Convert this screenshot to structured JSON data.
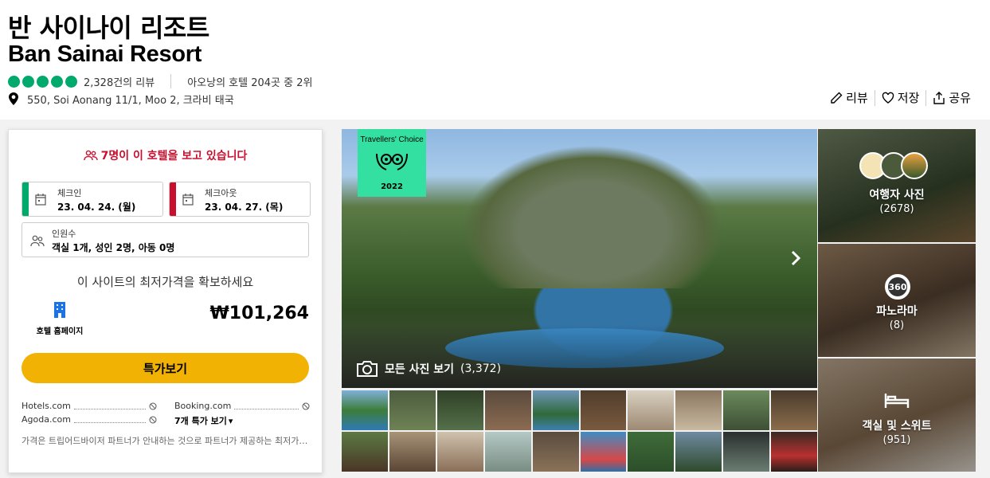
{
  "hotel": {
    "name_ko": "반 사이나이 리조트",
    "name_en": "Ban Sainai Resort",
    "reviews": "2,328건의 리뷰",
    "ranking": "아오낭의 호텔 204곳 중 2위",
    "address": "550, Soi Aonang 11/1, Moo 2, 크라비 태국",
    "rating_bubbles": 5,
    "rating_color": "#00aa6c"
  },
  "actions": {
    "review": "리뷰",
    "save": "저장",
    "share": "공유"
  },
  "booking": {
    "viewers": "7명이 이 호텔을 보고 있습니다",
    "checkin_label": "체크인",
    "checkin_value": "23. 04. 24. (월)",
    "checkout_label": "체크아웃",
    "checkout_value": "23. 04. 27. (목)",
    "guests_label": "인원수",
    "guests_value": "객실 1개, 성인 2명, 아동 0명",
    "best_price_title": "이 사이트의 최저가격을 확보하세요",
    "vendor_name": "호텔 홈페이지",
    "price": "₩101,264",
    "deal_button": "특가보기",
    "partners": [
      "Hotels.com",
      "Booking.com",
      "Agoda.com"
    ],
    "more_deals": "7개 특가 보기",
    "disclaimer": "가격은 트립어드바이저 파트너가 안내하는 것으로 파트너가 제공하는 최저가 정보입니다",
    "checkin_color": "#00aa6c",
    "checkout_color": "#c8102e",
    "deal_color": "#f2b203"
  },
  "gallery": {
    "badge_title": "Travellers' Choice",
    "badge_year": "2022",
    "all_photos": "모든 사진 보기",
    "all_photos_count": "(3,372)",
    "tiles": [
      {
        "label": "여행자 사진",
        "count": "(2678)"
      },
      {
        "label": "파노라마",
        "count": "(8)",
        "badge": "360"
      },
      {
        "label": "객실 및 스위트",
        "count": "(951)"
      }
    ]
  }
}
